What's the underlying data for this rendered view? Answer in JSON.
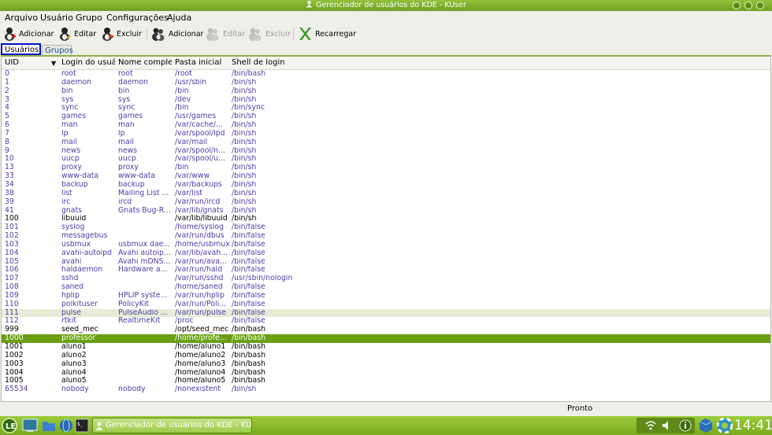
{
  "window": {
    "title": "Gerenciador de usuários do KDE - KUser"
  },
  "menu": [
    "Arquivo",
    "Usuário",
    "Grupo",
    "Configurações",
    "Ajuda"
  ],
  "toolbar": {
    "add_user": "Adicionar",
    "edit_user": "Editar",
    "delete_user": "Excluir",
    "add_group": "Adicionar",
    "edit_group": "Editar",
    "delete_group": "Excluir",
    "reload": "Recarregar"
  },
  "tabs": {
    "users": "Usuários",
    "groups": "Grupos"
  },
  "table": {
    "columns": [
      "UID",
      "Login do usuár",
      "Nome complet",
      "Pasta inicial",
      "Shell de login"
    ],
    "rows": [
      [
        "0",
        "root",
        "root",
        "/root",
        "/bin/bash"
      ],
      [
        "1",
        "daemon",
        "daemon",
        "/usr/sbin",
        "/bin/sh"
      ],
      [
        "2",
        "bin",
        "bin",
        "/bin",
        "/bin/sh"
      ],
      [
        "3",
        "sys",
        "sys",
        "/dev",
        "/bin/sh"
      ],
      [
        "4",
        "sync",
        "sync",
        "/bin",
        "/bin/sync"
      ],
      [
        "5",
        "games",
        "games",
        "/usr/games",
        "/bin/sh"
      ],
      [
        "6",
        "man",
        "man",
        "/var/cache/...",
        "/bin/sh"
      ],
      [
        "7",
        "lp",
        "lp",
        "/var/spool/lpd",
        "/bin/sh"
      ],
      [
        "8",
        "mail",
        "mail",
        "/var/mail",
        "/bin/sh"
      ],
      [
        "9",
        "news",
        "news",
        "/var/spool/n...",
        "/bin/sh"
      ],
      [
        "10",
        "uucp",
        "uucp",
        "/var/spool/u...",
        "/bin/sh"
      ],
      [
        "13",
        "proxy",
        "proxy",
        "/bin",
        "/bin/sh"
      ],
      [
        "33",
        "www-data",
        "www-data",
        "/var/www",
        "/bin/sh"
      ],
      [
        "34",
        "backup",
        "backup",
        "/var/backups",
        "/bin/sh"
      ],
      [
        "38",
        "list",
        "Mailing List ...",
        "/var/list",
        "/bin/sh"
      ],
      [
        "39",
        "irc",
        "ircd",
        "/var/run/ircd",
        "/bin/sh"
      ],
      [
        "41",
        "gnats",
        "Gnats Bug-R...",
        "/var/lib/gnats",
        "/bin/sh"
      ],
      [
        "100",
        "libuuid",
        "",
        "/var/lib/libuuid",
        "/bin/sh"
      ],
      [
        "101",
        "syslog",
        "",
        "/home/syslog",
        "/bin/false"
      ],
      [
        "102",
        "messagebus",
        "",
        "/var/run/dbus",
        "/bin/false"
      ],
      [
        "103",
        "usbmux",
        "usbmux dae...",
        "/home/usbmux",
        "/bin/false"
      ],
      [
        "104",
        "avahi-autoipd",
        "Avahi autoip...",
        "/var/lib/avah...",
        "/bin/false"
      ],
      [
        "105",
        "avahi",
        "Avahi mDNS...",
        "/var/run/ava...",
        "/bin/false"
      ],
      [
        "106",
        "haldaemon",
        "Hardware a...",
        "/var/run/hald",
        "/bin/false"
      ],
      [
        "107",
        "sshd",
        "",
        "/var/run/sshd",
        "/usr/sbin/nologin"
      ],
      [
        "108",
        "saned",
        "",
        "/home/saned",
        "/bin/false"
      ],
      [
        "109",
        "hplip",
        "HPLIP syste...",
        "/var/run/hplip",
        "/bin/false"
      ],
      [
        "110",
        "polkituser",
        "PolicyKit",
        "/var/run/Poli...",
        "/bin/false"
      ],
      [
        "111",
        "pulse",
        "PulseAudio ...",
        "/var/run/pulse",
        "/bin/false"
      ],
      [
        "112",
        "rtkit",
        "RealtimeKit",
        "/proc",
        "/bin/false"
      ],
      [
        "999",
        "seed_mec",
        "",
        "/opt/seed_mec",
        "/bin/bash"
      ],
      [
        "1000",
        "professor",
        "",
        "/home/profe...",
        "/bin/bash"
      ],
      [
        "1001",
        "aluno1",
        "",
        "/home/aluno1",
        "/bin/bash"
      ],
      [
        "1002",
        "aluno2",
        "",
        "/home/aluno2",
        "/bin/bash"
      ],
      [
        "1003",
        "aluno3",
        "",
        "/home/aluno3",
        "/bin/bash"
      ],
      [
        "1004",
        "aluno4",
        "",
        "/home/aluno4",
        "/bin/bash"
      ],
      [
        "1005",
        "aluno5",
        "",
        "/home/aluno5",
        "/bin/bash"
      ],
      [
        "65534",
        "nobody",
        "nobody",
        "/nonexistent",
        "/bin/sh"
      ]
    ],
    "dark_rows": [
      17,
      30,
      32,
      33,
      34,
      35,
      36
    ],
    "hover_row": 28,
    "selected_row": 31
  },
  "status": {
    "text": "Pronto"
  },
  "taskbar": {
    "task_label": "Gerenciador de usuários do KDE - KUser",
    "clock": "14:41"
  },
  "colors": {
    "accent": "#6aa010",
    "focus_border": "#0012c8",
    "link_text": "#4a3fa8"
  },
  "icons": [
    "user-add-icon",
    "user-edit-icon",
    "user-delete-icon",
    "group-add-icon",
    "group-edit-icon",
    "group-delete-icon",
    "reload-icon"
  ]
}
